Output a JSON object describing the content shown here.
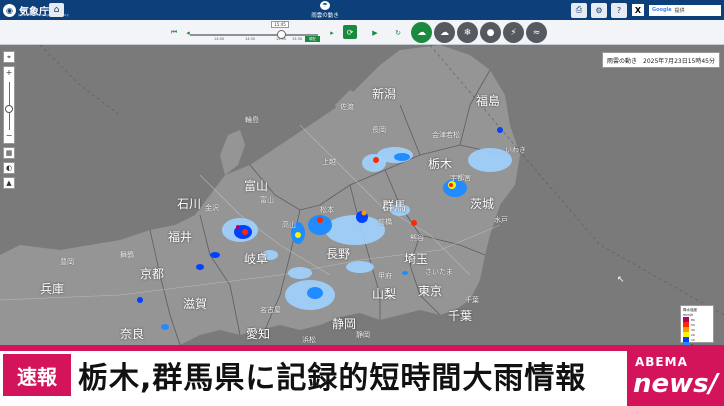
{
  "topbar": {
    "logo_text": "気象庁",
    "logo_sub": "Japan Meteorological Agency",
    "home_icon": "home-icon",
    "title": "雨雲の動き",
    "search_brand": "Google",
    "search_text": "提供",
    "x_label": "X"
  },
  "controlbar": {
    "current_time": "15:45",
    "ticks": [
      "14:00",
      "14:30",
      "15:00",
      "15:30"
    ],
    "now_label": "現在"
  },
  "map": {
    "timestamp": "雨雲の動き　2025年7月23日15時45分",
    "prefectures": [
      "新潟",
      "福島",
      "栃木",
      "茨城",
      "群馬",
      "石川",
      "富山",
      "福井",
      "岐阜",
      "長野",
      "山梨",
      "静岡",
      "愛知",
      "埼玉",
      "東京",
      "千葉",
      "京都",
      "兵庫",
      "滋賀",
      "奈良"
    ],
    "cities": [
      "佐渡",
      "上越",
      "長岡",
      "会津若松",
      "いわき",
      "宇都宮",
      "水戸",
      "前橋",
      "熊谷",
      "金沢",
      "輪島",
      "富山",
      "高山",
      "松本",
      "甲府",
      "名古屋",
      "静岡",
      "浜松",
      "さいたま",
      "千葉",
      "舞鶴",
      "豊岡"
    ],
    "legend": {
      "title": "降水強度",
      "unit": "mm/h",
      "rows": [
        {
          "label": "80",
          "color": "#b40068"
        },
        {
          "label": "50",
          "color": "#ff2800"
        },
        {
          "label": "30",
          "color": "#ff9900"
        },
        {
          "label": "20",
          "color": "#faf500"
        },
        {
          "label": "10",
          "color": "#0041ff"
        },
        {
          "label": "5",
          "color": "#218cff"
        },
        {
          "label": "1",
          "color": "#a0d2ff"
        }
      ]
    }
  },
  "banner": {
    "sokuhou": "速報",
    "headline": "栃木,群馬県に記録的短時間大雨情報",
    "brand_top": "ABEMA",
    "brand_bottom": "news/"
  }
}
